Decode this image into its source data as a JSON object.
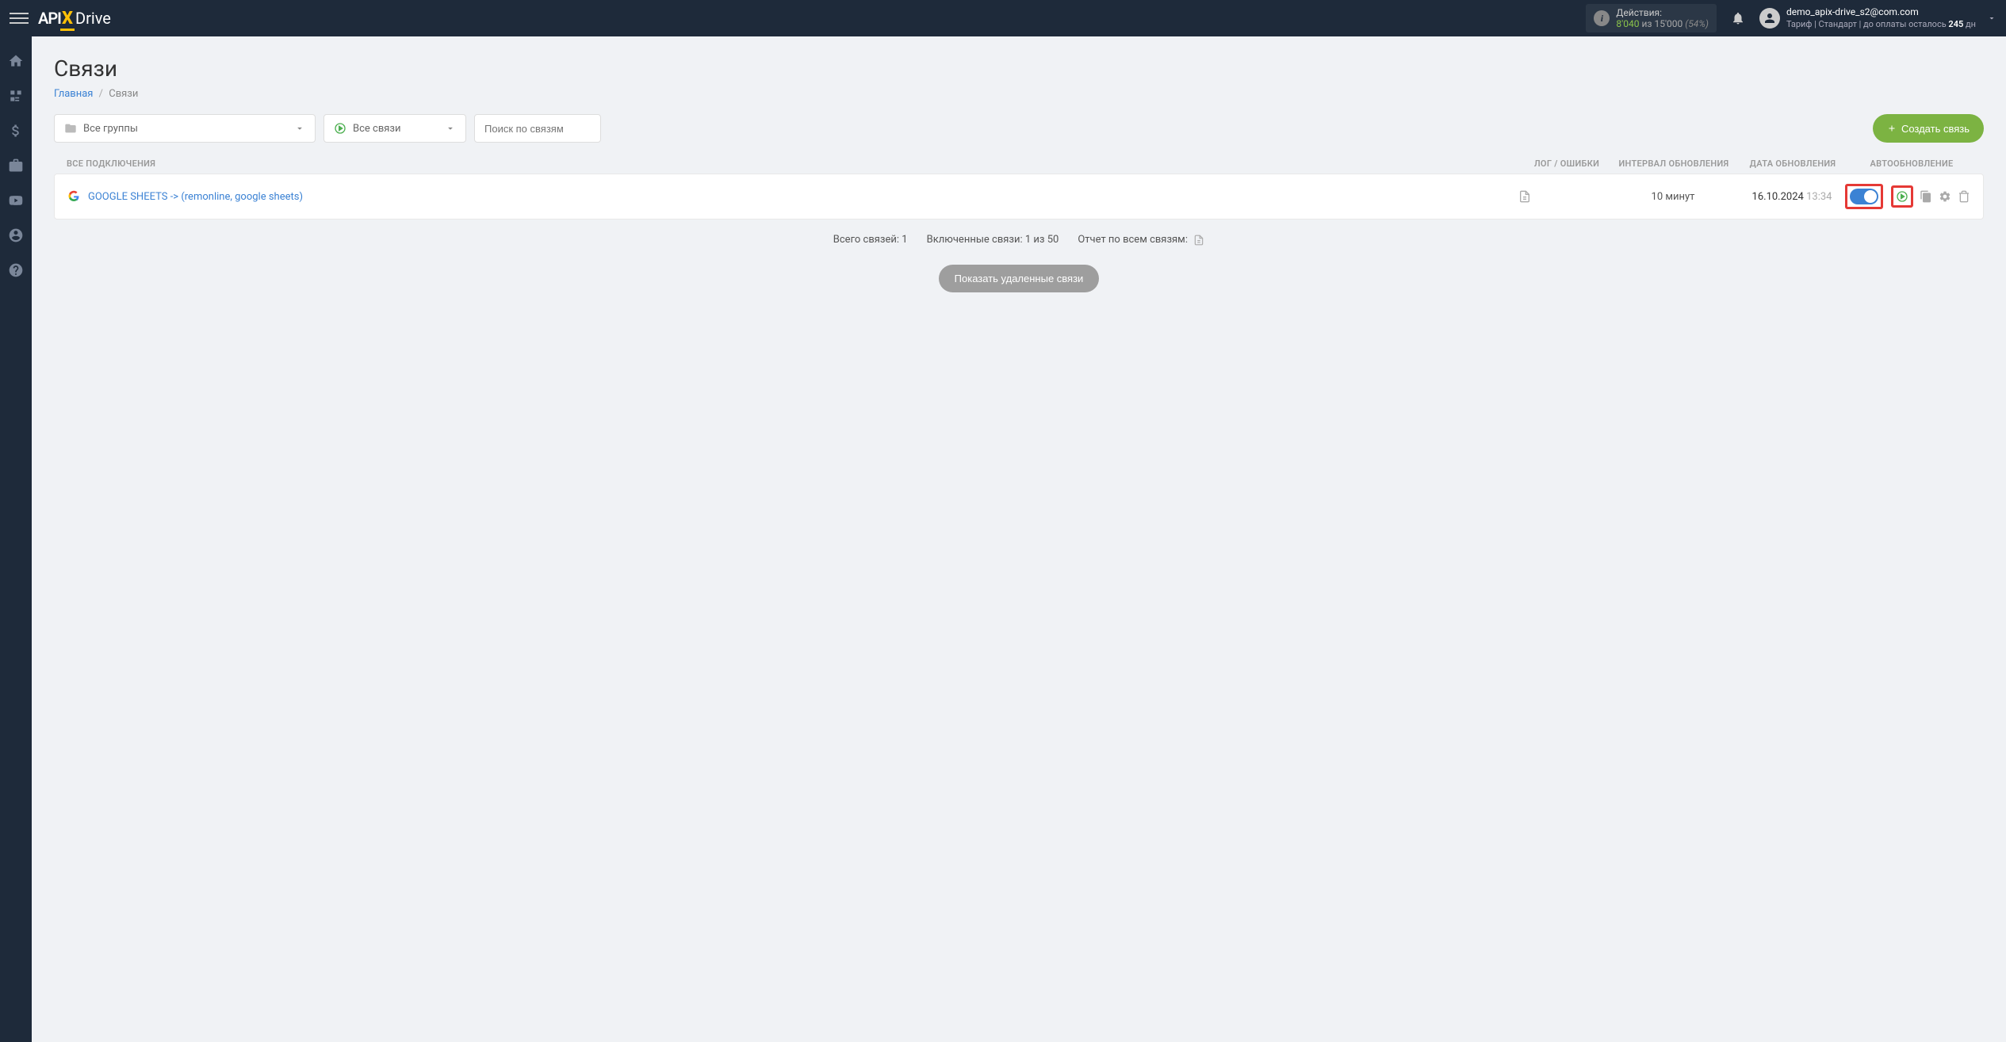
{
  "header": {
    "logo_parts": {
      "api": "API",
      "x": "X",
      "drive": "Drive"
    },
    "actions": {
      "label": "Действия:",
      "used": "8'040",
      "of_word": "из",
      "total": "15'000",
      "percent": "(54%)"
    },
    "user": {
      "email": "demo_apix-drive_s2@com.com",
      "tariff_prefix": "Тариф | Стандарт | до оплаты осталось ",
      "days": "245",
      "days_suffix": " дн"
    }
  },
  "sidebar": {
    "items": [
      {
        "name": "home-icon"
      },
      {
        "name": "sitemap-icon"
      },
      {
        "name": "dollar-icon"
      },
      {
        "name": "briefcase-icon"
      },
      {
        "name": "youtube-icon"
      },
      {
        "name": "user-icon"
      },
      {
        "name": "help-icon"
      }
    ]
  },
  "page": {
    "title": "Связи",
    "breadcrumb": {
      "home": "Главная",
      "current": "Связи"
    }
  },
  "filters": {
    "groups": "Все группы",
    "connections": "Все связи",
    "search_placeholder": "Поиск по связям",
    "create_button": "Создать связь"
  },
  "table": {
    "headers": {
      "name": "ВСЕ ПОДКЛЮЧЕНИЯ",
      "log": "ЛОГ / ОШИБКИ",
      "interval": "ИНТЕРВАЛ ОБНОВЛЕНИЯ",
      "date": "ДАТА ОБНОВЛЕНИЯ",
      "auto": "АВТООБНОВЛЕНИЕ"
    },
    "rows": [
      {
        "name": "GOOGLE SHEETS -> (remonline, google sheets)",
        "interval": "10 минут",
        "date": "16.10.2024",
        "time": "13:34",
        "auto_on": true
      }
    ]
  },
  "summary": {
    "total": "Всего связей: 1",
    "enabled": "Включенные связи: 1 из 50",
    "report": "Отчет по всем связям:"
  },
  "show_deleted": "Показать удаленные связи"
}
